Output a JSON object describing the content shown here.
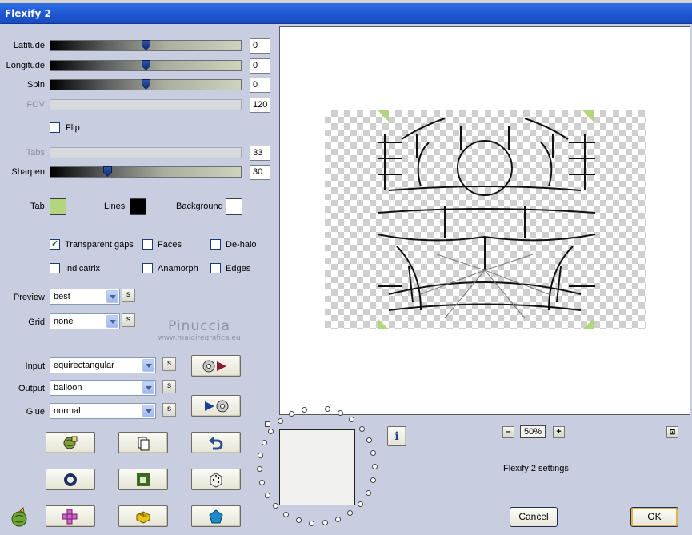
{
  "window": {
    "title": "Flexify 2"
  },
  "sliders": [
    {
      "id": "latitude",
      "label": "Latitude",
      "value": "0",
      "level": 0.5,
      "enabled": true
    },
    {
      "id": "longitude",
      "label": "Longitude",
      "value": "0",
      "level": 0.5,
      "enabled": true
    },
    {
      "id": "spin",
      "label": "Spin",
      "value": "0",
      "level": 0.5,
      "enabled": true
    },
    {
      "id": "fov",
      "label": "FOV",
      "value": "120",
      "level": null,
      "enabled": false
    },
    {
      "id": "tabs",
      "label": "Tabs",
      "value": "33",
      "level": null,
      "enabled": false
    },
    {
      "id": "sharpen",
      "label": "Sharpen",
      "value": "30",
      "level": 0.3,
      "enabled": true
    }
  ],
  "flip": {
    "label": "Flip",
    "checked": false
  },
  "colors": {
    "tab": {
      "label": "Tab",
      "color": "#b3d57e"
    },
    "lines": {
      "label": "Lines",
      "color": "#000000"
    },
    "background": {
      "label": "Background",
      "color": "#ffffff"
    }
  },
  "options": {
    "transparent_gaps": {
      "label": "Transparent gaps",
      "checked": true
    },
    "faces": {
      "label": "Faces",
      "checked": false
    },
    "de_halo": {
      "label": "De-halo",
      "checked": false
    },
    "indicatrix": {
      "label": "Indicatrix",
      "checked": false
    },
    "anamorph": {
      "label": "Anamorph",
      "checked": false
    },
    "edges": {
      "label": "Edges",
      "checked": false
    }
  },
  "preview_select": {
    "label": "Preview",
    "value": "best",
    "s": "s"
  },
  "grid_select": {
    "label": "Grid",
    "value": "none",
    "s": "s"
  },
  "watermark": {
    "line1": "Pinuccia",
    "line2": "www.maidiregrafica.eu"
  },
  "input_select": {
    "label": "Input",
    "value": "equirectangular",
    "s": "s"
  },
  "output_select": {
    "label": "Output",
    "value": "balloon",
    "s": "s"
  },
  "glue_select": {
    "label": "Glue",
    "value": "normal",
    "s": "s"
  },
  "zoom": {
    "minus": "–",
    "value": "50%",
    "plus": "+"
  },
  "info_icon": "i",
  "settings_label": "Flexify 2 settings",
  "buttons": {
    "cancel": "Cancel",
    "ok": "OK"
  },
  "accent_tab_color": "#b3d57e"
}
